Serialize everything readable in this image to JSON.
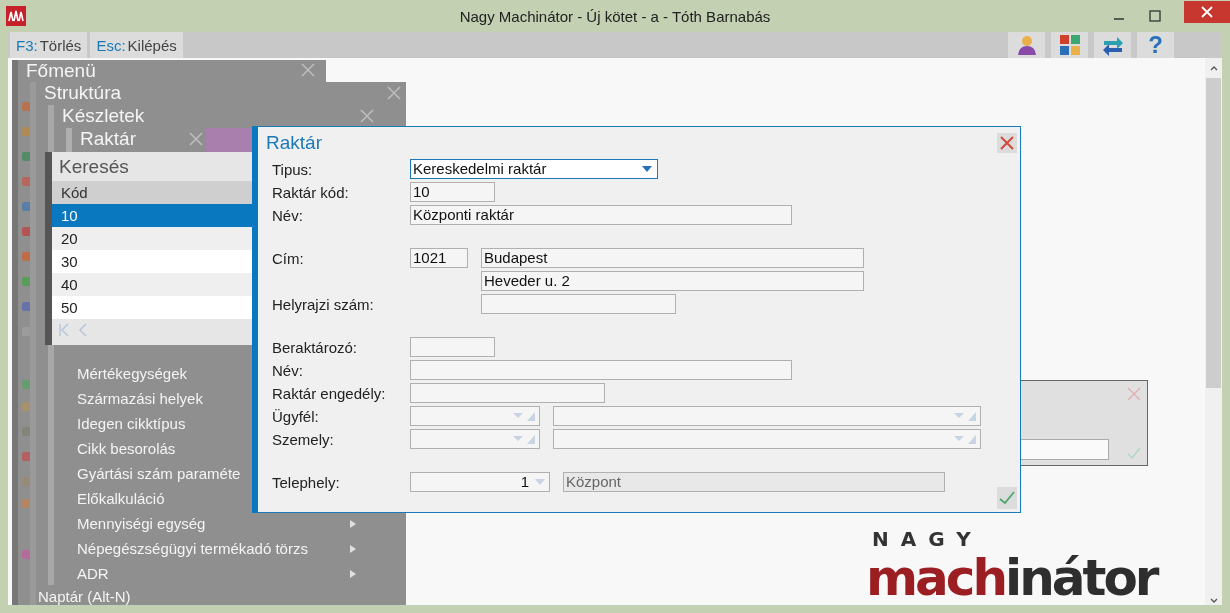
{
  "window": {
    "title": "Nagy Machinátor - Új kötet - a - Tóth Barnabás"
  },
  "toolbar": {
    "shortcuts": [
      {
        "key": "F3:",
        "label": "Törlés"
      },
      {
        "key": "Esc:",
        "label": "Kilépés"
      }
    ],
    "help_label": "?"
  },
  "menus": {
    "main_title": "Főmenü",
    "structure_title": "Struktúra",
    "stock_title": "Készletek",
    "warehouse_title": "Raktár",
    "stock_items": [
      {
        "label": "Mértékegységek"
      },
      {
        "label": "Származási helyek"
      },
      {
        "label": "Idegen cikktípus"
      },
      {
        "label": "Cikk besorolás"
      },
      {
        "label": "Gyártási szám paraméte"
      },
      {
        "label": "Előkalkuláció"
      },
      {
        "label": "Mennyiségi egység",
        "submenu": true
      },
      {
        "label": "Népegészségügyi termékadó törzs",
        "submenu": true
      },
      {
        "label": "ADR",
        "submenu": true
      }
    ],
    "structure_items": [
      {
        "label": "Naptár (Alt-N)"
      }
    ]
  },
  "search": {
    "title": "Keresés",
    "column": "Kód",
    "rows": [
      {
        "code": "10",
        "selected": true
      },
      {
        "code": "20",
        "selected": false
      },
      {
        "code": "30",
        "selected": false
      },
      {
        "code": "40",
        "selected": false
      },
      {
        "code": "50",
        "selected": false
      }
    ]
  },
  "dialog": {
    "title": "Raktár",
    "groups": [
      [
        {
          "kind": "dropdown",
          "label": "Tipus:",
          "value": "Kereskedelmi raktár"
        },
        {
          "kind": "text",
          "label": "Raktár kód:",
          "value": "10"
        },
        {
          "kind": "text",
          "label": "Név:",
          "value": "Központi raktár"
        }
      ],
      [
        {
          "kind": "address",
          "label": "Cím:",
          "zip": "1021",
          "value": "Budapest"
        },
        {
          "kind": "street",
          "value": "Heveder u. 2"
        },
        {
          "kind": "text",
          "label": "Helyrajzi szám:"
        }
      ],
      [
        {
          "kind": "text",
          "label": "Beraktározó:"
        },
        {
          "kind": "text",
          "label": "Név:"
        },
        {
          "kind": "text",
          "label": "Raktár engedély:"
        },
        {
          "kind": "combo",
          "label": "Ügyfél:"
        },
        {
          "kind": "combo",
          "label": "Szemely:"
        }
      ],
      [
        {
          "kind": "site",
          "label": "Telephely:",
          "value": "1",
          "name": "Központ"
        }
      ]
    ]
  },
  "logo": {
    "top": "NAGY",
    "parts": [
      "mach",
      "inátor"
    ]
  }
}
